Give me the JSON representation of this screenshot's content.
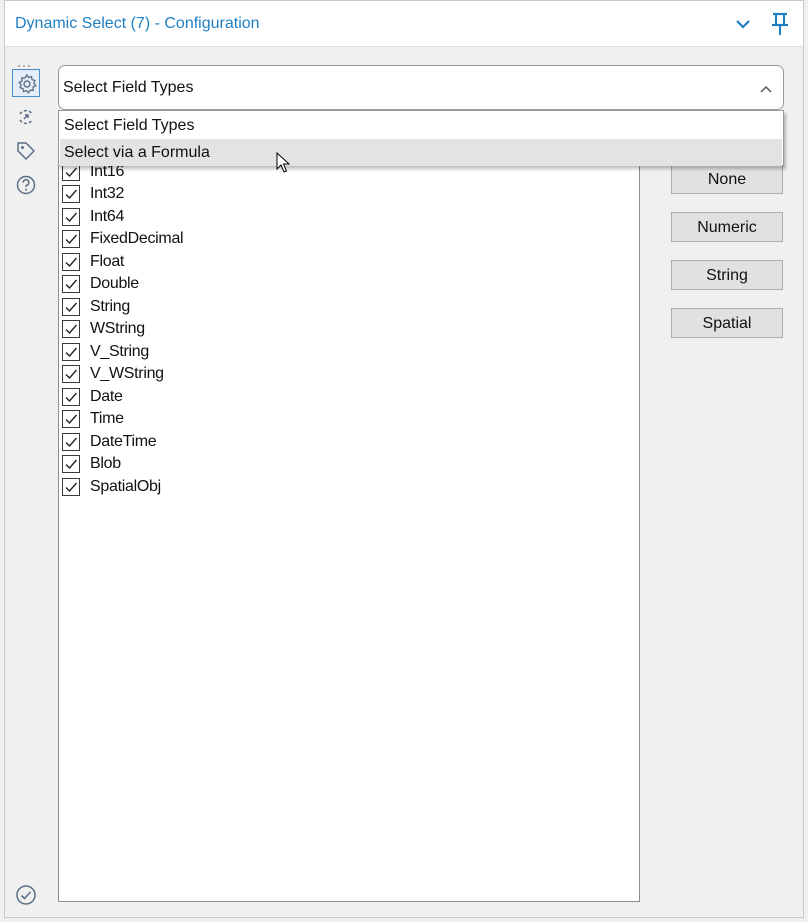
{
  "window": {
    "title": "Dynamic Select (7) - Configuration"
  },
  "sidebar": {
    "icons": [
      "gear-icon",
      "connection-icon",
      "tag-icon",
      "help-icon"
    ],
    "bottom_icon": "check-circle-icon"
  },
  "mode_select": {
    "selected": "Select Field Types",
    "options": [
      "Select Field Types",
      "Select via a Formula"
    ],
    "hovered": "Select via a Formula",
    "expanded": true
  },
  "field_types": {
    "items": [
      {
        "label": "Int16",
        "checked": true
      },
      {
        "label": "Int32",
        "checked": true
      },
      {
        "label": "Int64",
        "checked": true
      },
      {
        "label": "FixedDecimal",
        "checked": true
      },
      {
        "label": "Float",
        "checked": true
      },
      {
        "label": "Double",
        "checked": true
      },
      {
        "label": "String",
        "checked": true
      },
      {
        "label": "WString",
        "checked": true
      },
      {
        "label": "V_String",
        "checked": true
      },
      {
        "label": "V_WString",
        "checked": true
      },
      {
        "label": "Date",
        "checked": true
      },
      {
        "label": "Time",
        "checked": true
      },
      {
        "label": "DateTime",
        "checked": true
      },
      {
        "label": "Blob",
        "checked": true
      },
      {
        "label": "SpatialObj",
        "checked": true
      }
    ]
  },
  "buttons": {
    "none": "None",
    "numeric": "Numeric",
    "string": "String",
    "spatial": "Spatial"
  },
  "colors": {
    "accent": "#1e7fc4",
    "panel_bg": "#f0f0f0",
    "hover": "#e3e3e3"
  }
}
